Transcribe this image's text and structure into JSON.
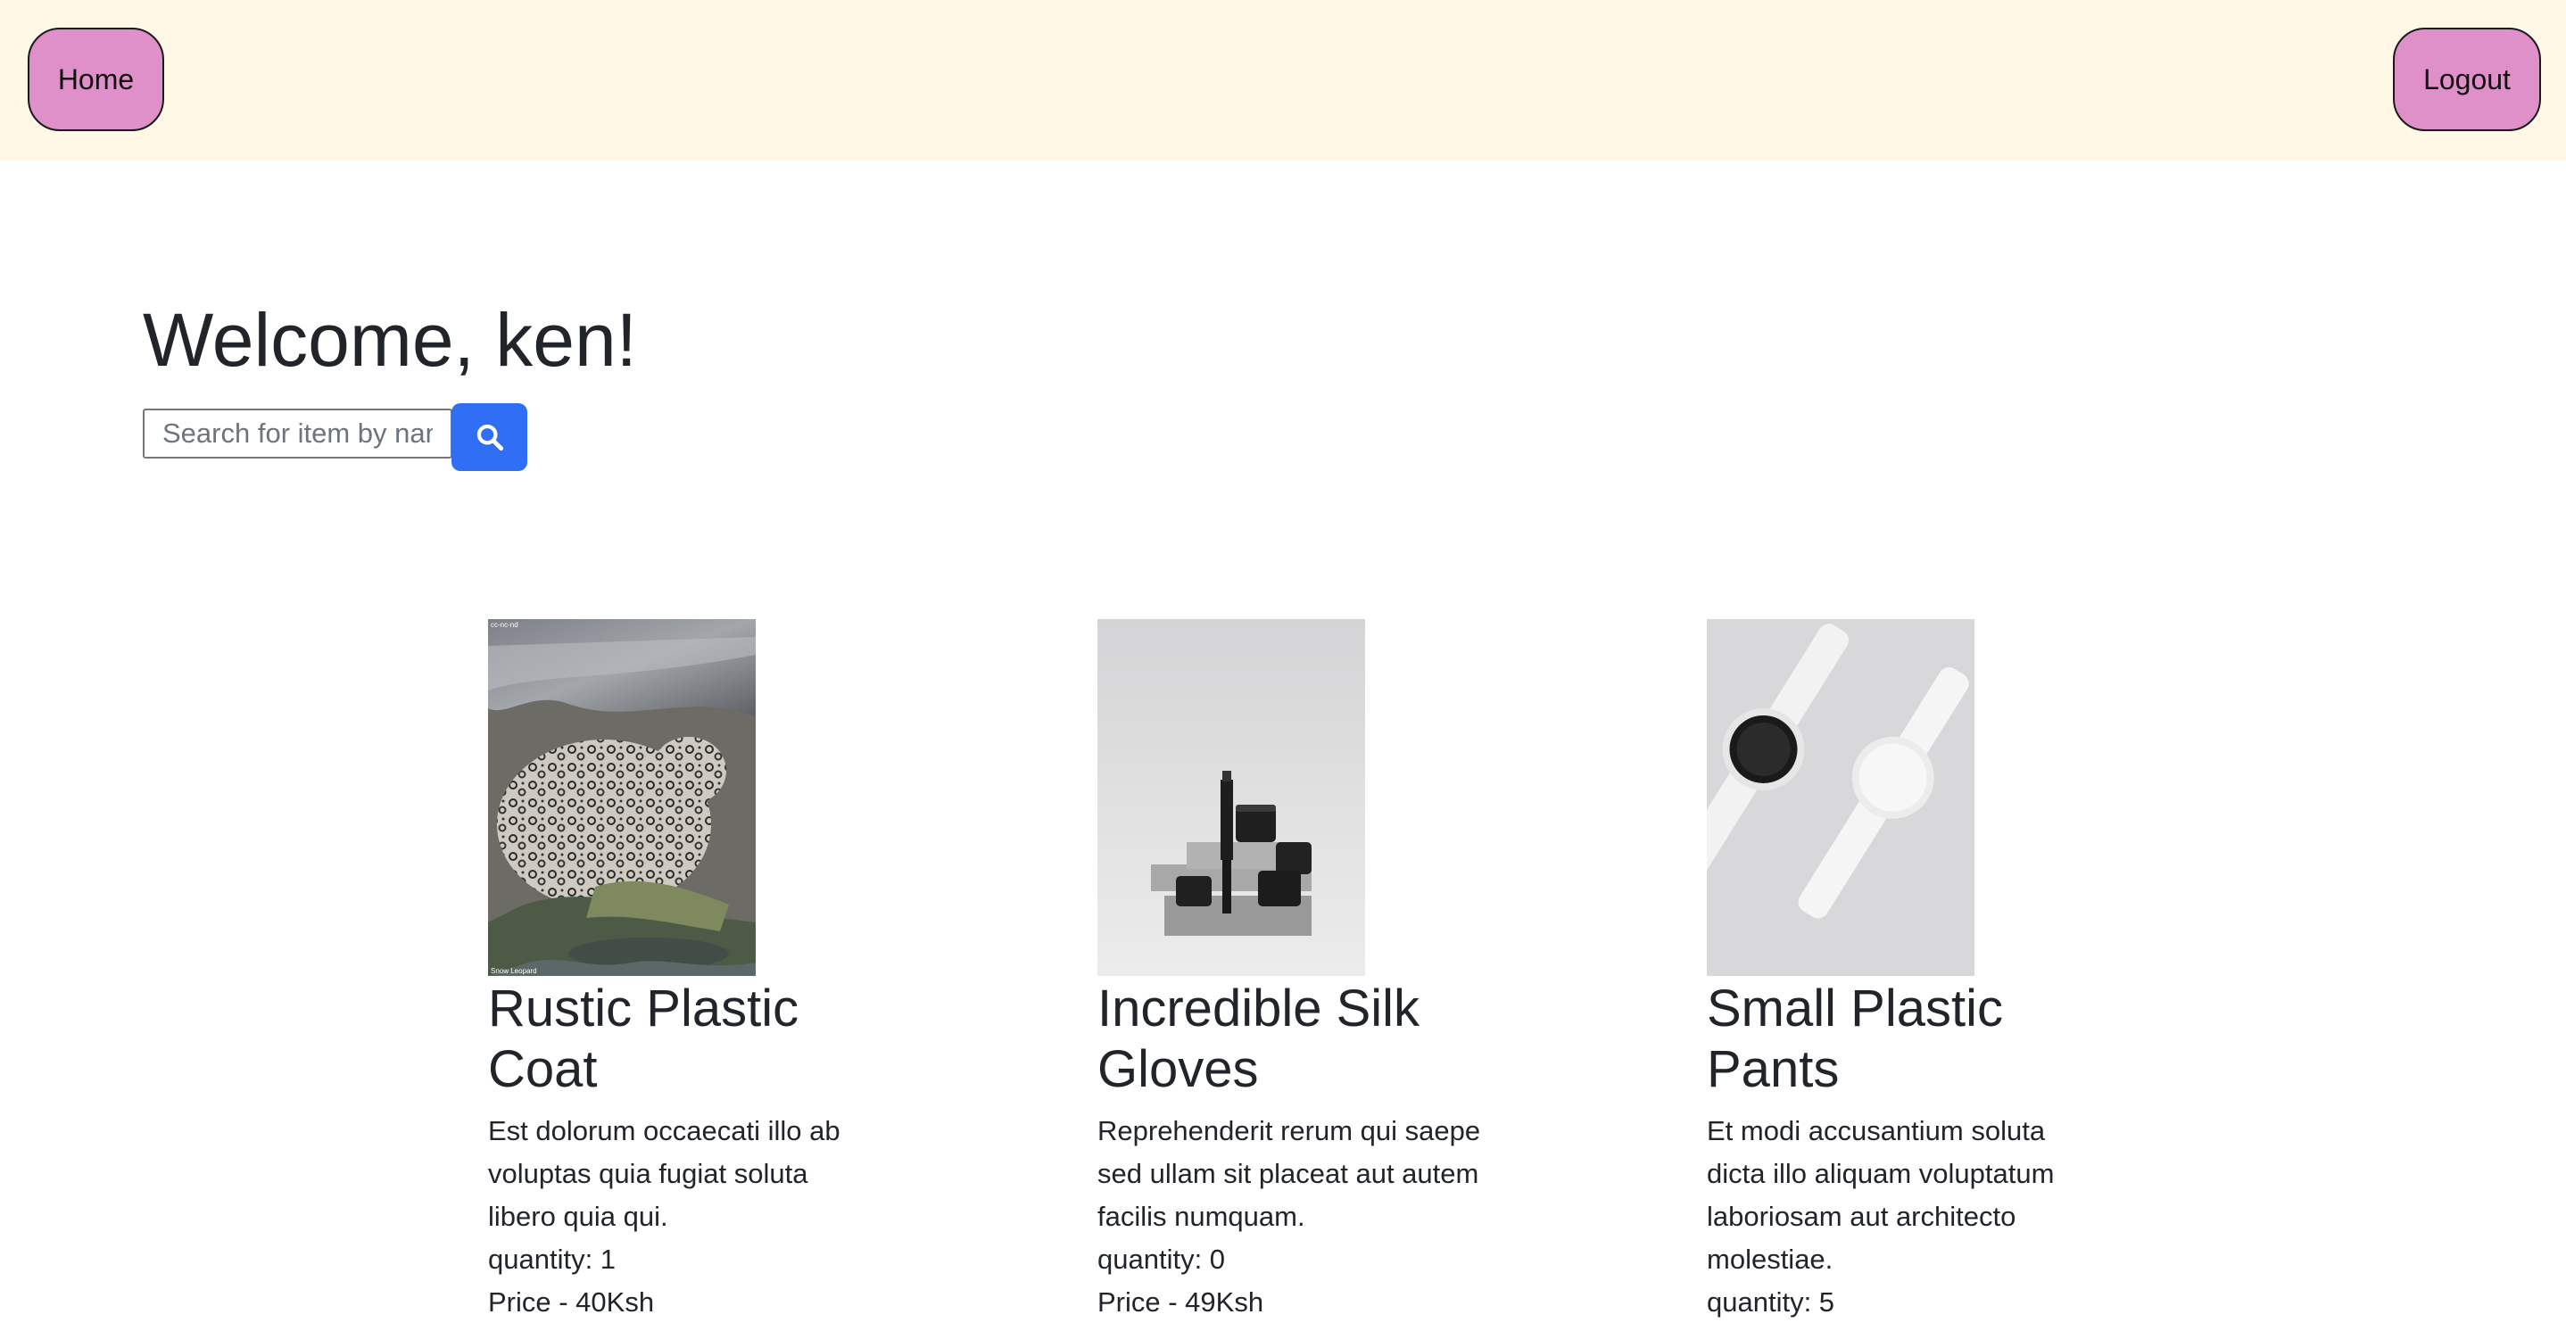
{
  "nav": {
    "home_label": "Home",
    "logout_label": "Logout"
  },
  "welcome": "Welcome, ken!",
  "search": {
    "placeholder": "Search for item by name",
    "value": ""
  },
  "colors": {
    "navbar_bg": "#fff8e7",
    "nav_button_bg": "#e090c8",
    "search_button_bg": "#2f6ef5"
  },
  "products": [
    {
      "image": "snow-leopard-photo",
      "image_caption_top": "cc-nc-nd",
      "image_caption_bottom": "Snow Leopard",
      "name": "Rustic Plastic Coat",
      "description": "Est dolorum occaecati illo ab voluptas quia fugiat soluta libero quia qui.",
      "quantity": "quantity: 1",
      "price": "Price - 40Ksh"
    },
    {
      "image": "cosmetics-jars-photo",
      "name": "Incredible Silk Gloves",
      "description": "Reprehenderit rerum qui saepe sed ullam sit placeat aut autem facilis numquam.",
      "quantity": "quantity: 0",
      "price": "Price - 49Ksh"
    },
    {
      "image": "smartwatches-photo",
      "name": "Small Plastic Pants",
      "description": "Et modi accusantium soluta dicta illo aliquam voluptatum laboriosam aut architecto molestiae.",
      "quantity": "quantity: 5",
      "price": ""
    }
  ]
}
